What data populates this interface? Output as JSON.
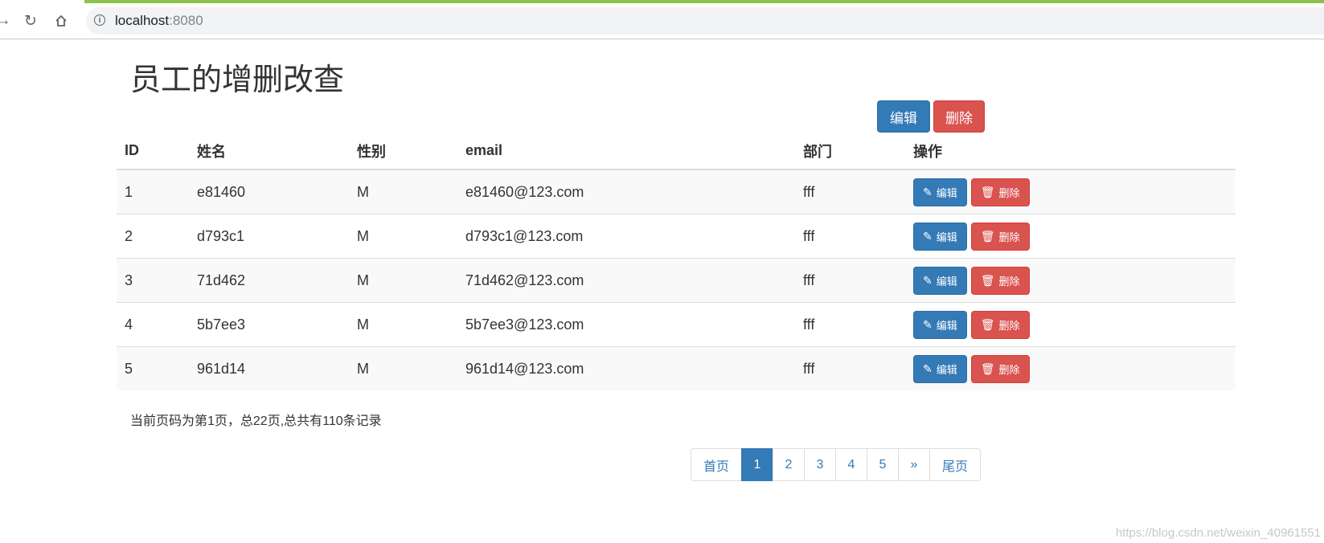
{
  "browser": {
    "url_host": "localhost",
    "url_port": ":8080"
  },
  "page": {
    "title": "员工的增删改查",
    "top_edit_label": "编辑",
    "top_delete_label": "删除"
  },
  "table": {
    "headers": [
      "ID",
      "姓名",
      "性别",
      "email",
      "部门",
      "操作"
    ],
    "rows": [
      {
        "id": "1",
        "name": "e81460",
        "gender": "M",
        "email": "e81460@123.com",
        "dept": "fff"
      },
      {
        "id": "2",
        "name": "d793c1",
        "gender": "M",
        "email": "d793c1@123.com",
        "dept": "fff"
      },
      {
        "id": "3",
        "name": "71d462",
        "gender": "M",
        "email": "71d462@123.com",
        "dept": "fff"
      },
      {
        "id": "4",
        "name": "5b7ee3",
        "gender": "M",
        "email": "5b7ee3@123.com",
        "dept": "fff"
      },
      {
        "id": "5",
        "name": "961d14",
        "gender": "M",
        "email": "961d14@123.com",
        "dept": "fff"
      }
    ],
    "row_edit_label": "编辑",
    "row_delete_label": "删除"
  },
  "page_info": "当前页码为第1页，总22页,总共有110条记录",
  "pagination": {
    "items": [
      {
        "label": "首页",
        "active": false
      },
      {
        "label": "1",
        "active": true
      },
      {
        "label": "2",
        "active": false
      },
      {
        "label": "3",
        "active": false
      },
      {
        "label": "4",
        "active": false
      },
      {
        "label": "5",
        "active": false
      },
      {
        "label": "»",
        "active": false
      },
      {
        "label": "尾页",
        "active": false
      }
    ]
  },
  "watermark": "https://blog.csdn.net/weixin_40961551",
  "colors": {
    "primary": "#337ab7",
    "danger": "#d9534f",
    "loadbar": "#8bc34a"
  }
}
